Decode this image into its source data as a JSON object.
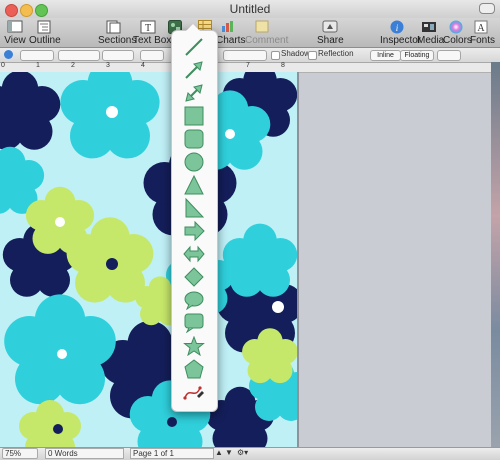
{
  "window": {
    "title": "Untitled"
  },
  "toolbar": {
    "view": "View",
    "outline": "Outline",
    "sections": "Sections",
    "text_box": "Text Box",
    "shapes": "S",
    "charts": "Charts",
    "comment": "Comment",
    "share": "Share",
    "inspector": "Inspector",
    "media": "Media",
    "colors": "Colors",
    "fonts": "Fonts"
  },
  "format_bar": {
    "shadow": "Shadow",
    "reflection": "Reflection",
    "inline": "Inline",
    "floating": "Floating"
  },
  "ruler": {
    "marks": [
      "0",
      "1",
      "2",
      "3",
      "4",
      "5",
      "6",
      "7",
      "8"
    ]
  },
  "status_bar": {
    "zoom": "75%",
    "word_count": "0 Words",
    "page_indicator": "Page 1 of 1"
  },
  "shapes_menu": {
    "items": [
      "line-icon",
      "arrow-line-icon",
      "double-arrow-line-icon",
      "square-icon",
      "rounded-square-icon",
      "circle-icon",
      "triangle-icon",
      "right-triangle-icon",
      "arrow-icon",
      "double-arrow-icon",
      "diamond-icon",
      "speech-bubble-icon",
      "callout-square-icon",
      "star-icon",
      "pentagon-icon",
      "pen-tool-icon"
    ]
  },
  "colors": {
    "shape_fill": "#7cc49a",
    "shape_stroke": "#3e8e5f",
    "pattern_cyan": "#2fd0dc",
    "pattern_navy": "#141e5a",
    "pattern_lime": "#c6e86a"
  }
}
